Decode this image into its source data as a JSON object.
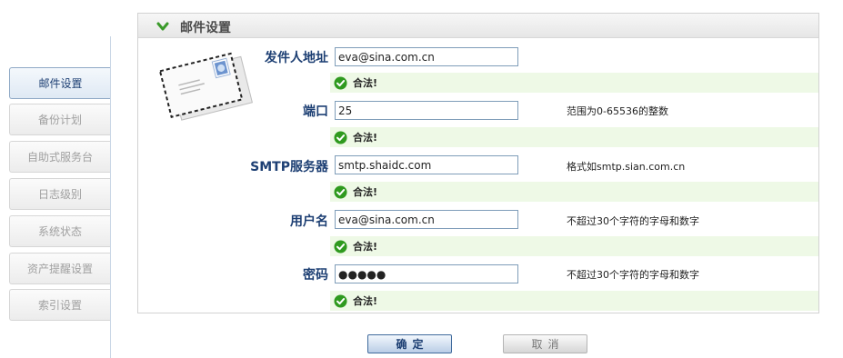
{
  "sidebar": {
    "items": [
      {
        "label": "邮件设置",
        "active": true
      },
      {
        "label": "备份计划",
        "active": false
      },
      {
        "label": "自助式服务台",
        "active": false
      },
      {
        "label": "日志级别",
        "active": false
      },
      {
        "label": "系统状态",
        "active": false
      },
      {
        "label": "资产提醒设置",
        "active": false
      },
      {
        "label": "索引设置",
        "active": false
      }
    ]
  },
  "panel": {
    "title": "邮件设置",
    "icon": "chevron-down-icon",
    "illustration": "envelope-icon"
  },
  "form": {
    "sender": {
      "label": "发件人地址",
      "value": "eva@sina.com.cn",
      "hint": "",
      "status": "合法!"
    },
    "port": {
      "label": "端口",
      "value": "25",
      "hint": "范围为0-65536的整数",
      "status": "合法!"
    },
    "smtp": {
      "label": "SMTP服务器",
      "value": "smtp.shaidc.com",
      "hint": "格式如smtp.sian.com.cn",
      "status": "合法!"
    },
    "username": {
      "label": "用户名",
      "value": "eva@sina.com.cn",
      "hint": "不超过30个字符的字母和数字",
      "status": "合法!"
    },
    "password": {
      "label": "密码",
      "value": "●●●●●",
      "hint": "不超过30个字符的字母和数字",
      "status": "合法!"
    }
  },
  "buttons": {
    "ok": "确定",
    "cancel": "取消"
  },
  "colors": {
    "accent": "#1d3f73",
    "valid_bg": "#eef9e6",
    "check_green": "#2f9a1f"
  }
}
